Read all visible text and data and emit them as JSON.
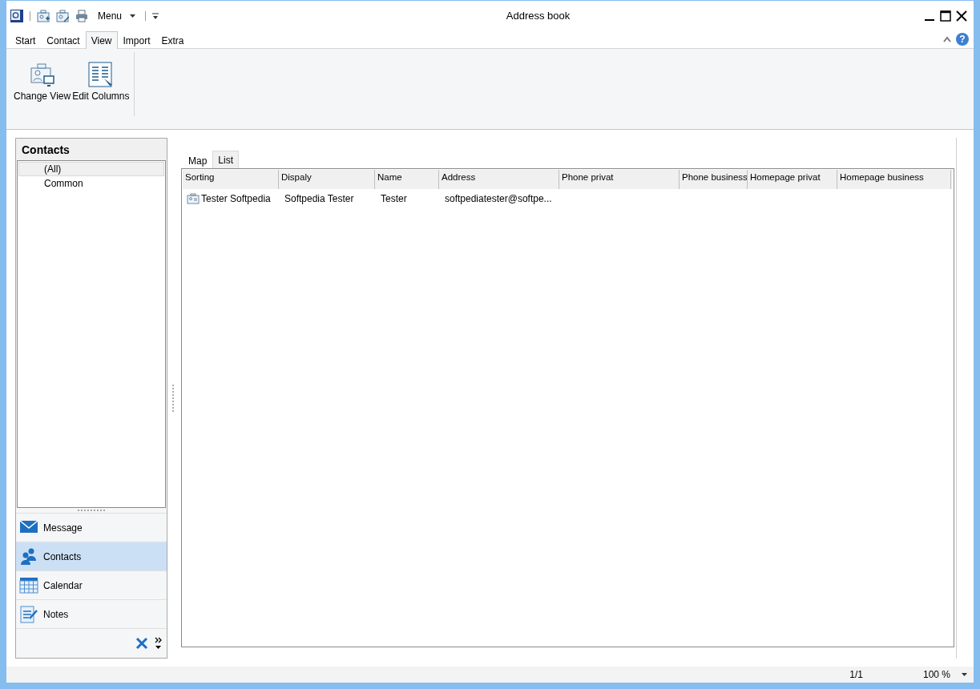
{
  "window": {
    "title": "Address book"
  },
  "quick_access": {
    "menu": "Menu"
  },
  "ribbon_tabs": [
    {
      "label": "Start",
      "selected": false
    },
    {
      "label": "Contact",
      "selected": false
    },
    {
      "label": "View",
      "selected": true
    },
    {
      "label": "Import",
      "selected": false
    },
    {
      "label": "Extra",
      "selected": false
    }
  ],
  "help_button": {
    "label": "?"
  },
  "ribbon": {
    "buttons": [
      {
        "kind": "view",
        "label": "Change View"
      },
      {
        "kind": "columns",
        "label": "Edit Columns"
      }
    ]
  },
  "sidebar": {
    "title": "Contacts",
    "groups": [
      {
        "label": "(All)",
        "selected": true
      },
      {
        "label": "Common",
        "selected": false
      }
    ],
    "nav": [
      {
        "kind": "mail",
        "label": "Message",
        "selected": false
      },
      {
        "kind": "contacts",
        "label": "Contacts",
        "selected": true
      },
      {
        "kind": "calendar",
        "label": "Calendar",
        "selected": false
      },
      {
        "kind": "notes",
        "label": "Notes",
        "selected": false
      }
    ]
  },
  "view_tabs": [
    {
      "label": "Map",
      "selected": false
    },
    {
      "label": "List",
      "selected": true
    }
  ],
  "table": {
    "columns": [
      "Sorting",
      "Dispaly",
      "Name",
      "Address",
      "Phone privat",
      "Phone business",
      "Homepage privat",
      "Homepage business"
    ],
    "rows": [
      [
        "Tester Softpedia",
        "Softpedia Tester",
        "Tester",
        "softpediatester@softpe...",
        "",
        "",
        "",
        ""
      ]
    ]
  },
  "status_bar": {
    "page": "1/1",
    "zoom": "100 %"
  }
}
